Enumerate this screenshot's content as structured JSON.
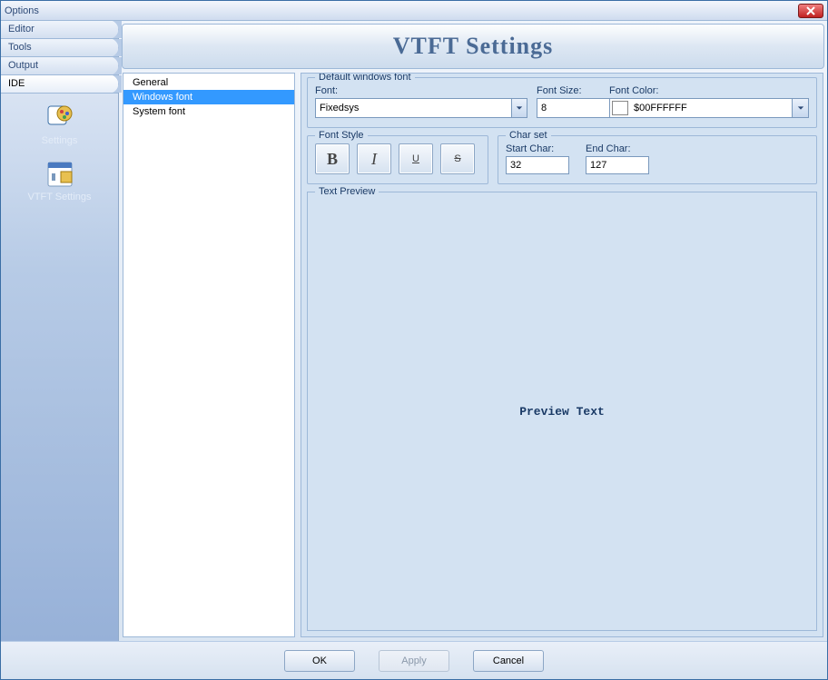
{
  "window": {
    "title": "Options"
  },
  "sidebar": {
    "tabs": [
      "Editor",
      "Tools",
      "Output",
      "IDE"
    ],
    "active_index": 3,
    "icons": [
      {
        "label": "Settings"
      },
      {
        "label": "VTFT Settings"
      }
    ]
  },
  "header": {
    "title": "VTFT Settings"
  },
  "tree": {
    "items": [
      "General",
      "Windows font",
      "System font"
    ],
    "selected_index": 1
  },
  "defaults_group": {
    "legend": "Default windows font",
    "font_label": "Font:",
    "font_value": "Fixedsys",
    "size_label": "Font Size:",
    "size_value": "8",
    "color_label": "Font Color:",
    "color_value": "$00FFFFFF",
    "color_swatch": "#FFFFFF"
  },
  "fontstyle": {
    "legend": "Font Style",
    "bold": "B",
    "italic": "I",
    "underline": "U",
    "strike": "S"
  },
  "charset": {
    "legend": "Char set",
    "start_label": "Start Char:",
    "start_value": "32",
    "end_label": "End Char:",
    "end_value": "127"
  },
  "preview": {
    "legend": "Text Preview",
    "text": "Preview Text"
  },
  "footer": {
    "ok": "OK",
    "apply": "Apply",
    "cancel": "Cancel"
  }
}
